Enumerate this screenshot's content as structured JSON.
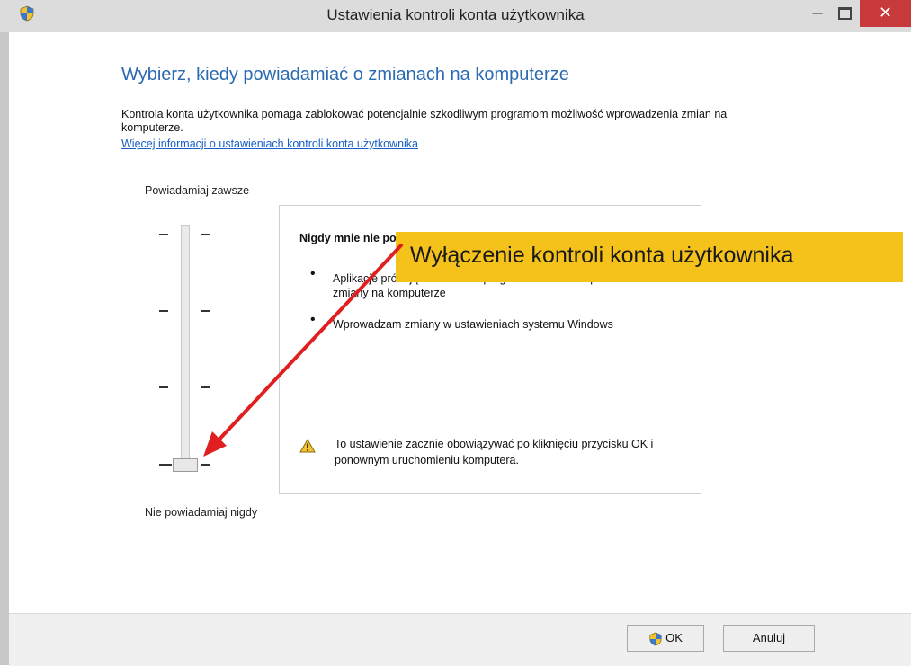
{
  "window": {
    "title": "Ustawienia kontroli konta użytkownika",
    "minimize_glyph": "–",
    "close_glyph": "✕",
    "title_icon": "shield-icon"
  },
  "main": {
    "headline": "Wybierz, kiedy powiadamiać o zmianach na komputerze",
    "description": "Kontrola konta użytkownika pomaga zablokować potencjalnie szkodliwym programom możliwość wprowadzenia zmian na komputerze.",
    "more_info_link": "Więcej informacji o ustawieniach kontroli konta użytkownika"
  },
  "slider": {
    "top_label": "Powiadamiaj zawsze",
    "bottom_label": "Nie powiadamiaj nigdy",
    "levels": 4,
    "current_level": 0
  },
  "panel": {
    "title": "Nigdy mnie nie powiadamiaj, gdy:",
    "bullets": [
      "Aplikacje próbują instalować oprogramowanie lub wprowadzać zmiany na komputerze",
      "Wprowadzam zmiany w ustawieniach systemu Windows"
    ],
    "warning": "To ustawienie zacznie obowiązywać po kliknięciu przycisku OK i ponownym uruchomieniu komputera."
  },
  "callout": {
    "text": "Wyłączenie kontroli konta użytkownika",
    "color": "#f5c21b",
    "arrow_color": "#e02020"
  },
  "buttons": {
    "ok": "OK",
    "cancel": "Anuluj"
  }
}
